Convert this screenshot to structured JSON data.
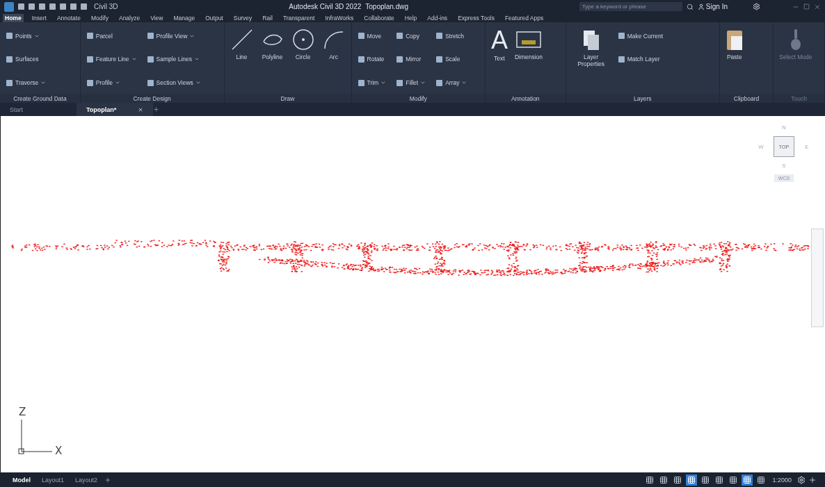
{
  "title_bar": {
    "workspace": "Civil 3D",
    "app_title": "Autodesk Civil 3D 2022",
    "file_name": "Topoplan.dwg",
    "search": {
      "placeholder": "Type a keyword or phrase"
    },
    "sign_in": "Sign In"
  },
  "ribbon_tabs": [
    {
      "label": "Home",
      "selected": true
    },
    {
      "label": "Insert",
      "selected": false
    },
    {
      "label": "Annotate",
      "selected": false
    },
    {
      "label": "Modify",
      "selected": false
    },
    {
      "label": "Analyze",
      "selected": false
    },
    {
      "label": "View",
      "selected": false
    },
    {
      "label": "Manage",
      "selected": false
    },
    {
      "label": "Output",
      "selected": false
    },
    {
      "label": "Survey",
      "selected": false
    },
    {
      "label": "Rail",
      "selected": false
    },
    {
      "label": "Transparent",
      "selected": false
    },
    {
      "label": "InfraWorks",
      "selected": false
    },
    {
      "label": "Collaborate",
      "selected": false
    },
    {
      "label": "Help",
      "selected": false
    },
    {
      "label": "Add-ins",
      "selected": false
    },
    {
      "label": "Express Tools",
      "selected": false
    },
    {
      "label": "Featured Apps",
      "selected": false
    }
  ],
  "ribbon_panels": [
    {
      "label": "Create Ground Data",
      "disabled": false,
      "tools": [
        {
          "kind": "small",
          "label": "Points",
          "menu": true
        },
        {
          "kind": "small",
          "label": "Surfaces",
          "menu": false
        },
        {
          "kind": "small",
          "label": "Traverse",
          "menu": true
        }
      ]
    },
    {
      "label": "Create Design",
      "disabled": false,
      "tools": [
        {
          "kind": "small",
          "label": "Parcel",
          "menu": false
        },
        {
          "kind": "small",
          "label": "Feature Line",
          "menu": true
        },
        {
          "kind": "small",
          "label": "Profile",
          "menu": true
        },
        {
          "kind": "small",
          "label": "Profile View",
          "menu": true
        },
        {
          "kind": "small",
          "label": "Sample Lines",
          "menu": true
        },
        {
          "kind": "small",
          "label": "Section Views",
          "menu": true
        }
      ]
    },
    {
      "label": "Draw",
      "disabled": false,
      "tools": [
        {
          "kind": "line",
          "label": "Line",
          "menu": false
        },
        {
          "kind": "polyline",
          "label": "Polyline",
          "menu": false
        },
        {
          "kind": "circle",
          "label": "Circle",
          "menu": false
        },
        {
          "kind": "arc",
          "label": "Arc",
          "menu": false
        }
      ]
    },
    {
      "label": "Modify",
      "disabled": false,
      "tools": [
        {
          "kind": "small",
          "label": "Move",
          "menu": false
        },
        {
          "kind": "small",
          "label": "Rotate",
          "menu": false
        },
        {
          "kind": "small",
          "label": "Trim",
          "menu": true
        },
        {
          "kind": "small",
          "label": "Copy",
          "menu": false
        },
        {
          "kind": "small",
          "label": "Mirror",
          "menu": false
        },
        {
          "kind": "small",
          "label": "Fillet",
          "menu": true
        },
        {
          "kind": "small",
          "label": "Stretch",
          "menu": false
        },
        {
          "kind": "small",
          "label": "Scale",
          "menu": false
        },
        {
          "kind": "small",
          "label": "Array",
          "menu": true
        }
      ]
    },
    {
      "label": "Annotation",
      "disabled": false,
      "tools": [
        {
          "kind": "glyph",
          "glyph": "A",
          "label": "Text",
          "menu": false
        },
        {
          "kind": "dimension",
          "label": "Dimension",
          "menu": false
        }
      ]
    },
    {
      "label": "Layers",
      "disabled": false,
      "tools": [
        {
          "kind": "layer",
          "label": "Layer Properties",
          "menu": false
        },
        {
          "kind": "small",
          "label": "Make Current",
          "menu": false
        },
        {
          "kind": "small",
          "label": "Match Layer",
          "menu": false
        }
      ]
    },
    {
      "label": "Clipboard",
      "disabled": false,
      "tools": [
        {
          "kind": "paste",
          "label": "Paste",
          "menu": false
        }
      ]
    },
    {
      "label": "Touch",
      "disabled": true,
      "tools": [
        {
          "kind": "touch",
          "label": "Select Mode",
          "menu": false
        }
      ]
    }
  ],
  "doc_tabs": [
    {
      "label": "Start",
      "selected": false,
      "closable": false
    },
    {
      "label": "Topoplan*",
      "selected": true,
      "closable": true
    }
  ],
  "viewcube": {
    "face": "TOP",
    "north": "N",
    "west": "W",
    "east": "E",
    "south": "S",
    "coordinate_system": "WCS"
  },
  "ucs": {
    "z": "Z",
    "x": "X"
  },
  "layout_tabs": [
    {
      "label": "Model",
      "selected": true
    },
    {
      "label": "Layout1",
      "selected": false
    },
    {
      "label": "Layout2",
      "selected": false
    }
  ],
  "status_bar": {
    "toggles": [
      {
        "on": false
      },
      {
        "on": false
      },
      {
        "on": false
      },
      {
        "on": true
      },
      {
        "on": false
      },
      {
        "on": false
      },
      {
        "on": false
      },
      {
        "on": true
      },
      {
        "on": false
      }
    ],
    "scale": "1:2000"
  }
}
